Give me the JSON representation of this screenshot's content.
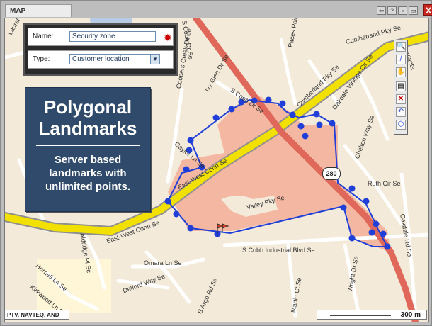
{
  "window": {
    "tab_title": "MAP",
    "buttons": [
      "restore",
      "help",
      "minimize",
      "maximize"
    ],
    "close_label": "X"
  },
  "form": {
    "name_label": "Name:",
    "name_value": "Security zone",
    "type_label": "Type:",
    "type_value": "Customer location"
  },
  "promo": {
    "title_line1": "Polygonal",
    "title_line2": "Landmarks",
    "body": "Server based landmarks with unlimited points."
  },
  "map": {
    "shield_label": "280",
    "street_labels": [
      "Laurel Summit",
      "S Cobb Dr Se",
      "Cumberland Pky Se",
      "Atlanta",
      "Paces Point Cir Se",
      "Coopers Creek Dr Se",
      "Ivy Glen Dr Se",
      "S Cobb Dr Se",
      "Cumberland Pky Se",
      "Oakdale Vinings Cir Se",
      "Gaylor Ln Se",
      "East-West Conn Se",
      "Chelton Way Se",
      "Ruth Cir Se",
      "Valley Pky Se",
      "East-West Conn Se",
      "S Cobb Industrial Blvd Se",
      "Omara Ln Se",
      "Delford Way Se",
      "Hornell Ln Se",
      "Kirkwood Ln Se",
      "Aldridge Pl Se",
      "S Argo Rd Se",
      "Martin Ct Se",
      "Wright Dr Se",
      "Oakdale Rd Se"
    ]
  },
  "copyright": "PTV, NAVTEQ, AND",
  "scale": "300 m",
  "colors": {
    "polygon": "#1f3fd8",
    "zone_fill": "#f4b7a1",
    "highway": "#f2e100",
    "arterial": "#f07b6b",
    "water": "#b8cbe5",
    "promo_bg": "#2f4a6b"
  }
}
